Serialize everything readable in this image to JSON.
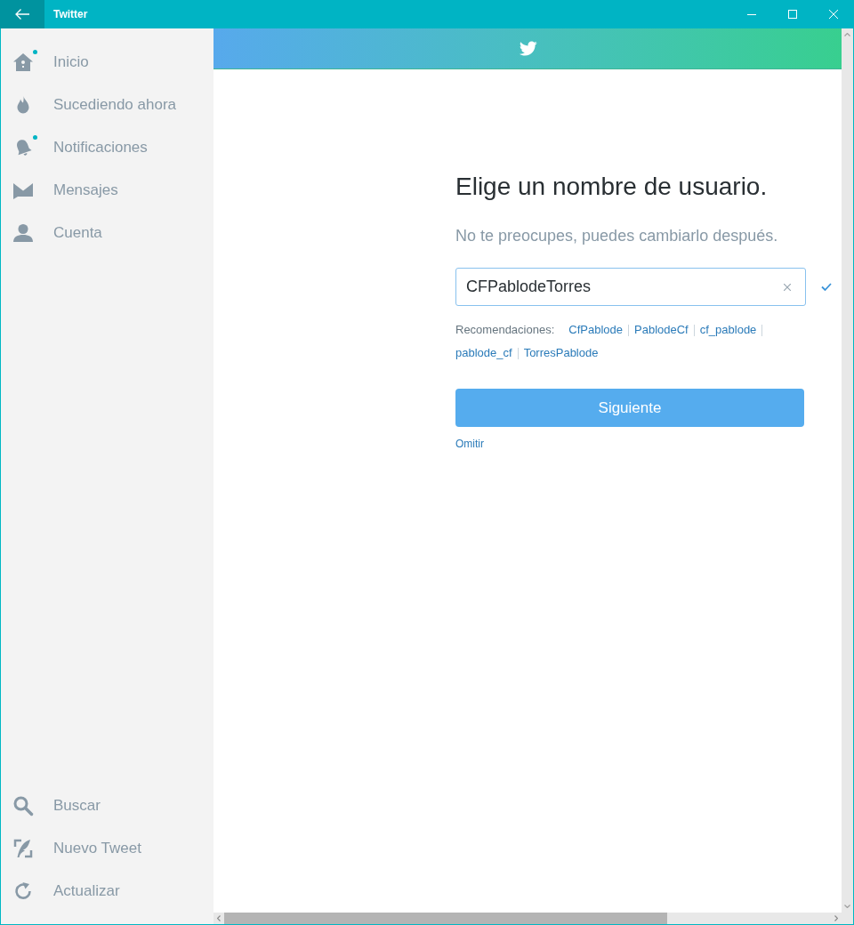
{
  "window": {
    "title": "Twitter"
  },
  "sidebar": {
    "items": [
      {
        "label": "Inicio",
        "unread": true
      },
      {
        "label": "Sucediendo ahora",
        "unread": false
      },
      {
        "label": "Notificaciones",
        "unread": true
      },
      {
        "label": "Mensajes",
        "unread": false
      },
      {
        "label": "Cuenta",
        "unread": false
      }
    ],
    "bottom_items": [
      {
        "label": "Buscar"
      },
      {
        "label": "Nuevo Tweet"
      },
      {
        "label": "Actualizar"
      }
    ]
  },
  "form": {
    "heading": "Elige un nombre de usuario.",
    "subtitle": "No te preocupes, puedes cambiarlo después.",
    "username_field": {
      "value": "CFPablodeTorres",
      "valid": true
    },
    "recommendations": {
      "label": "Recomendaciones:",
      "options": [
        "CfPablode",
        "PablodeCf",
        "cf_pablode",
        "pablode_cf",
        "TorresPablode"
      ]
    },
    "next_button": "Siguiente",
    "skip_link": "Omitir"
  }
}
